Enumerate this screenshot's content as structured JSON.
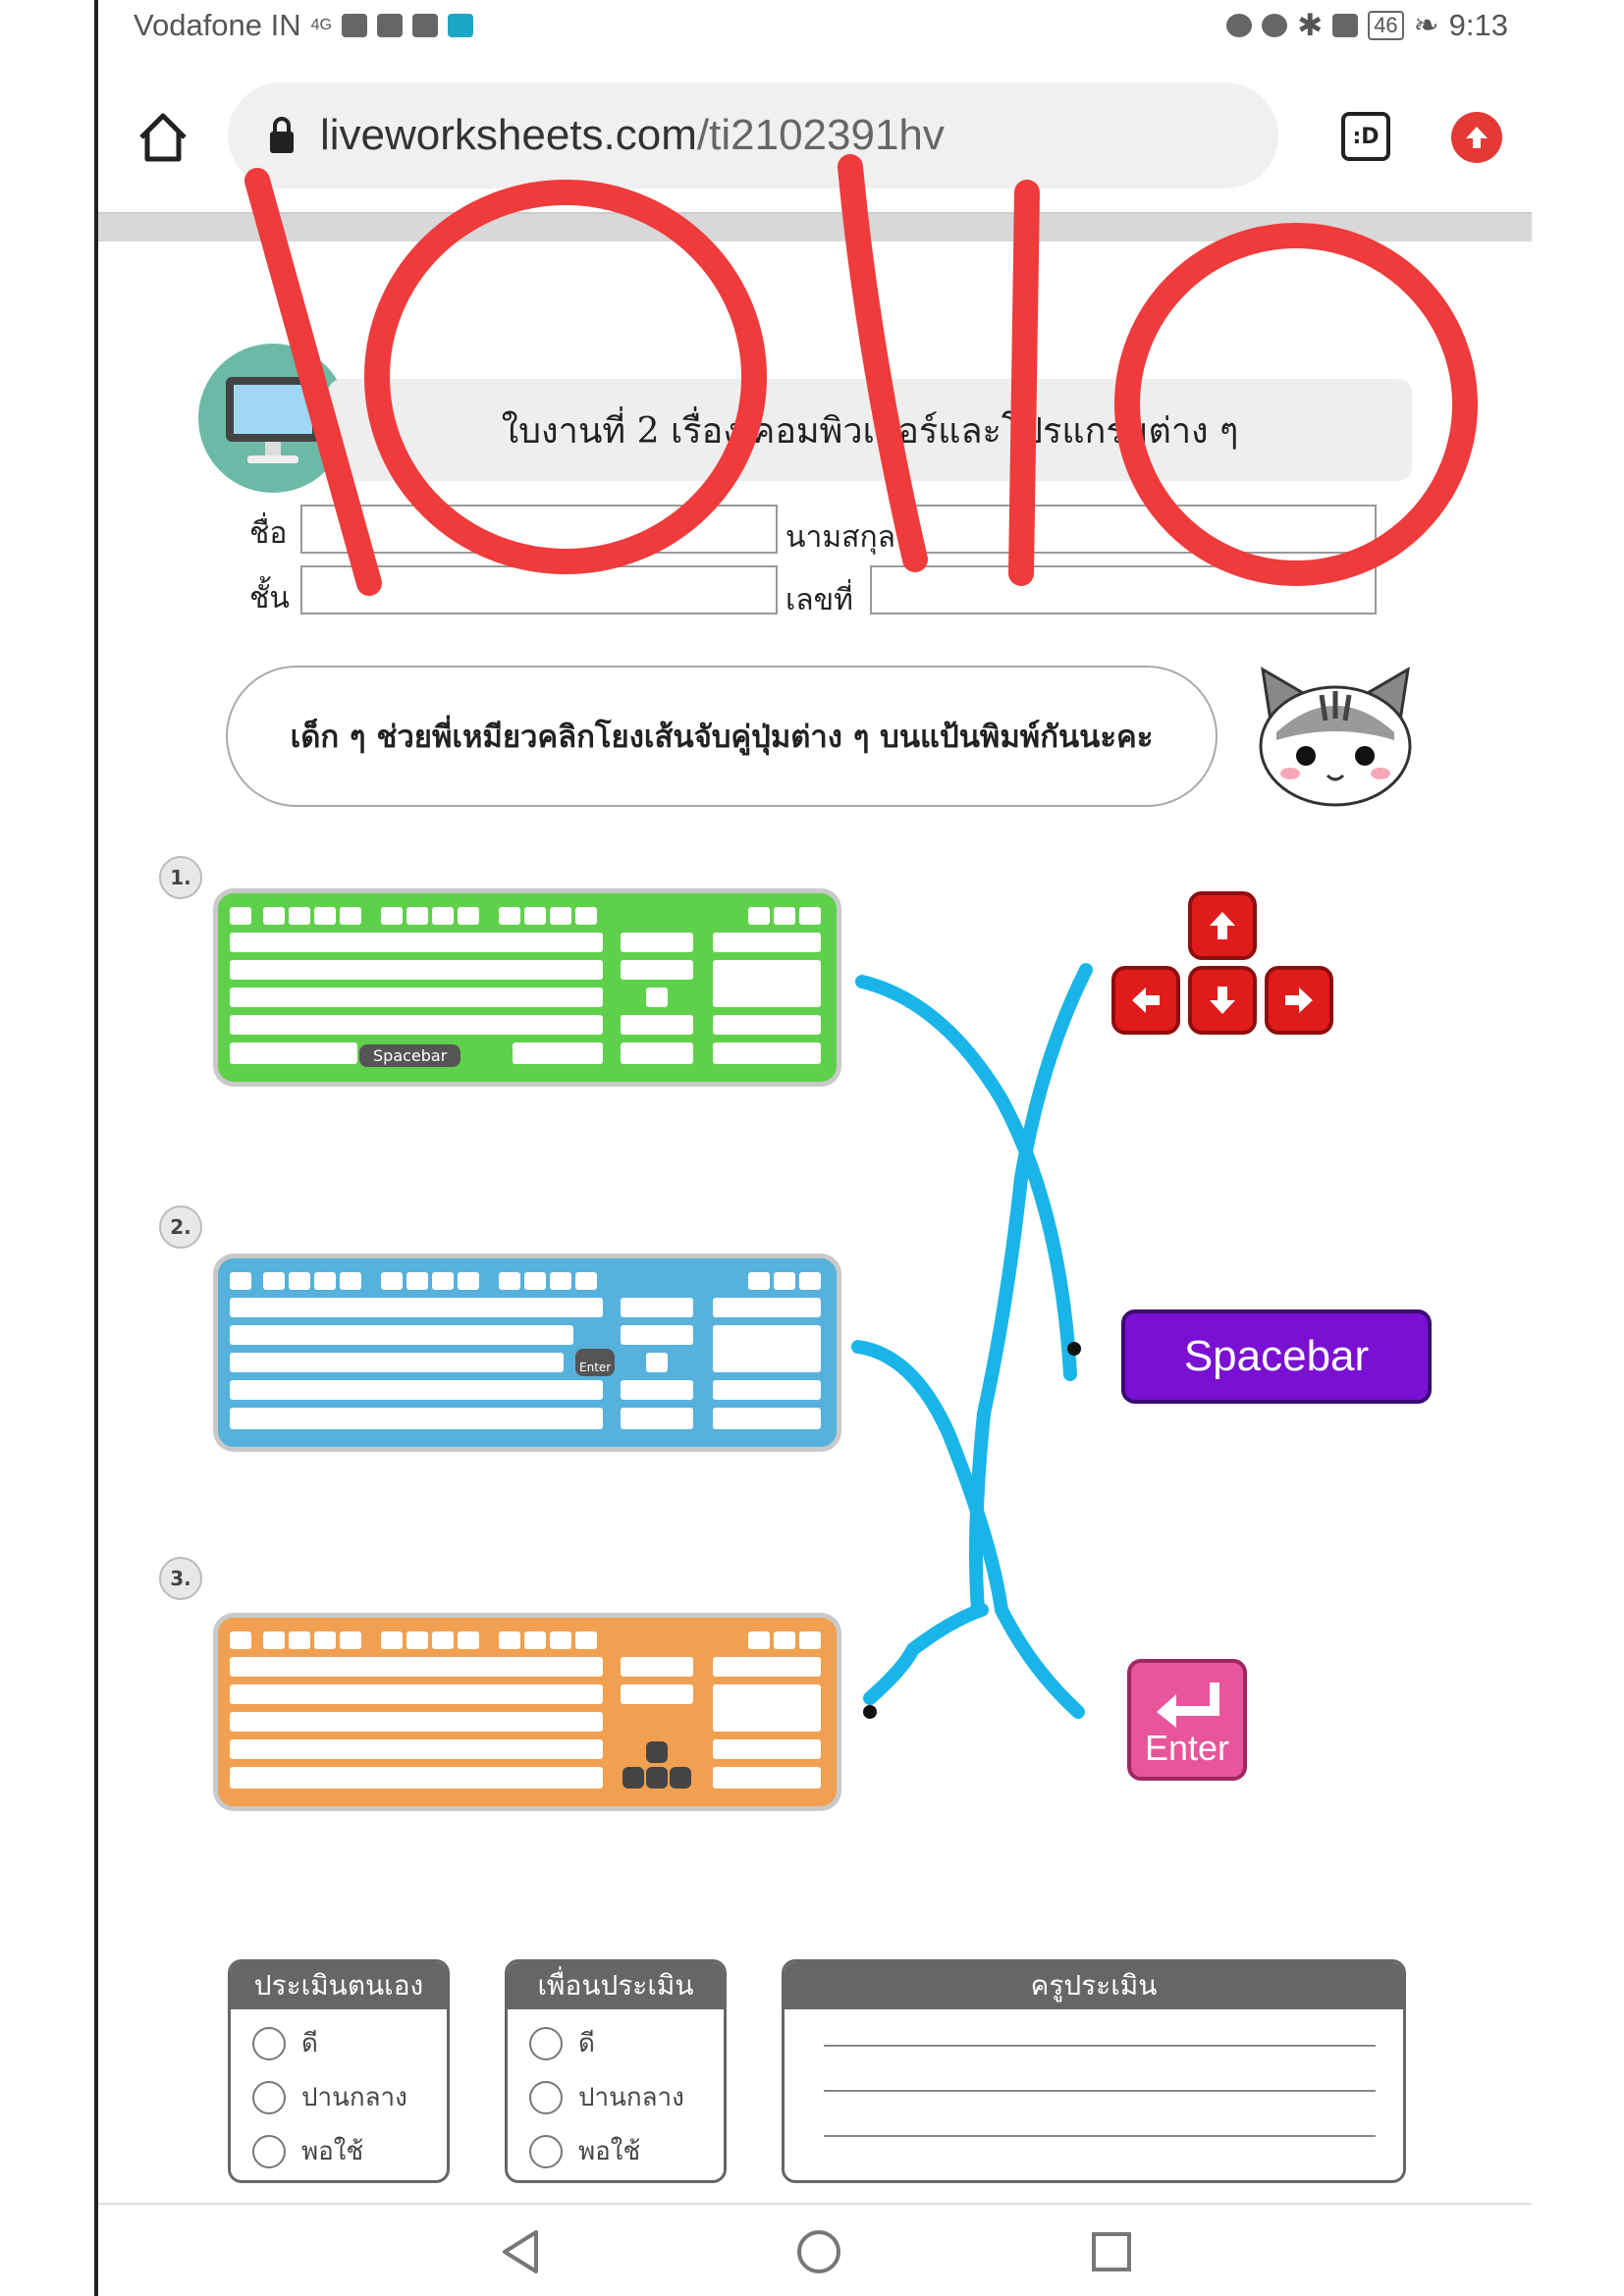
{
  "status": {
    "carrier": "Vodafone IN",
    "signal": "4G",
    "battery": "46",
    "time": "9:13"
  },
  "browser": {
    "url_domain": "liveworksheets.com",
    "url_path": "/ti2102391hv",
    "tab_button": ":D"
  },
  "worksheet": {
    "title": "ใบงานที่ 2 เรื่อง คอมพิวเตอร์และโปรแกรมต่าง ๆ",
    "fields": {
      "name_label": "ชื่อ",
      "surname_label": "นามสกุล",
      "class_label": "ชั้น",
      "number_label": "เลขที่"
    },
    "instruction": "เด็ก ๆ ช่วยพี่เหมียวคลิกโยงเส้นจับคู่ปุ่มต่าง ๆ บนแป้นพิมพ์กันนะคะ",
    "items": [
      {
        "number": "1.",
        "highlight_label": "Spacebar",
        "color": "#5fd04a"
      },
      {
        "number": "2.",
        "highlight_label": "Enter",
        "color": "#56b1dc"
      },
      {
        "number": "3.",
        "highlight_label": "",
        "color": "#f0a050"
      }
    ],
    "answers": {
      "spacebar": "Spacebar",
      "enter": "Enter"
    }
  },
  "evaluation": {
    "self": {
      "title": "ประเมินตนเอง",
      "options": [
        "ดี",
        "ปานกลาง",
        "พอใช้"
      ]
    },
    "peer": {
      "title": "เพื่อนประเมิน",
      "options": [
        "ดี",
        "ปานกลาง",
        "พอใช้"
      ]
    },
    "teacher": {
      "title": "ครูประเมิน"
    }
  },
  "annotation": {
    "handwritten_red": "1010"
  },
  "colors": {
    "handwriting_red": "#ef3b3b",
    "match_lines_blue": "#19b5e8",
    "spacebar_purple": "#7a10d2",
    "enter_pink": "#e8559a",
    "arrow_red": "#e01b1b"
  }
}
